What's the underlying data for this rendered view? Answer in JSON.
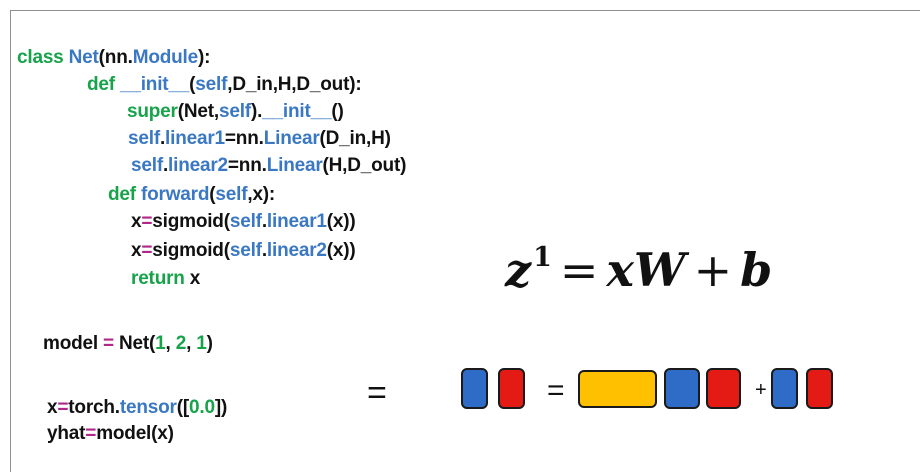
{
  "code": {
    "lines": [
      [
        {
          "t": "class ",
          "c": "keyword"
        },
        {
          "t": "Net",
          "c": "name"
        },
        {
          "t": "(nn.",
          "c": "plain"
        },
        {
          "t": "Module",
          "c": "name"
        },
        {
          "t": "):",
          "c": "plain"
        }
      ],
      [
        {
          "t": "def ",
          "c": "keyword"
        },
        {
          "t": "__init__",
          "c": "name"
        },
        {
          "t": "(",
          "c": "plain"
        },
        {
          "t": "self",
          "c": "name"
        },
        {
          "t": ",D_in,H,D_out):",
          "c": "plain"
        }
      ],
      [
        {
          "t": "super",
          "c": "keyword"
        },
        {
          "t": "(Net,",
          "c": "plain"
        },
        {
          "t": "self",
          "c": "name"
        },
        {
          "t": ").",
          "c": "plain"
        },
        {
          "t": "__init__",
          "c": "name"
        },
        {
          "t": "()",
          "c": "plain"
        }
      ],
      [
        {
          "t": "self",
          "c": "name"
        },
        {
          "t": ".",
          "c": "plain"
        },
        {
          "t": "linear1",
          "c": "name"
        },
        {
          "t": "=nn.",
          "c": "plain"
        },
        {
          "t": "Linear",
          "c": "name"
        },
        {
          "t": "(D_in,H)",
          "c": "plain"
        }
      ],
      [
        {
          "t": "self",
          "c": "name"
        },
        {
          "t": ".",
          "c": "plain"
        },
        {
          "t": "linear2",
          "c": "name"
        },
        {
          "t": "=nn.",
          "c": "plain"
        },
        {
          "t": "Linear",
          "c": "name"
        },
        {
          "t": "(H,D_out)",
          "c": "plain"
        }
      ],
      [
        {
          "t": "def ",
          "c": "keyword"
        },
        {
          "t": "forward",
          "c": "name"
        },
        {
          "t": "(",
          "c": "plain"
        },
        {
          "t": "self",
          "c": "name"
        },
        {
          "t": ",x):",
          "c": "plain"
        }
      ],
      [
        {
          "t": "x",
          "c": "plain"
        },
        {
          "t": "=",
          "c": "pink"
        },
        {
          "t": "sigmoid(",
          "c": "plain"
        },
        {
          "t": "self",
          "c": "name"
        },
        {
          "t": ".",
          "c": "plain"
        },
        {
          "t": "linear1",
          "c": "name"
        },
        {
          "t": "(x))",
          "c": "plain"
        }
      ],
      [
        {
          "t": "x",
          "c": "plain"
        },
        {
          "t": "=",
          "c": "pink"
        },
        {
          "t": "sigmoid(",
          "c": "plain"
        },
        {
          "t": "self",
          "c": "name"
        },
        {
          "t": ".",
          "c": "plain"
        },
        {
          "t": "linear2",
          "c": "name"
        },
        {
          "t": "(x))",
          "c": "plain"
        }
      ],
      [
        {
          "t": "return ",
          "c": "keyword"
        },
        {
          "t": "x",
          "c": "plain"
        }
      ],
      [
        {
          "t": "model ",
          "c": "plain"
        },
        {
          "t": "=",
          "c": "pink"
        },
        {
          "t": " Net(",
          "c": "plain"
        },
        {
          "t": "1",
          "c": "keyword"
        },
        {
          "t": ", ",
          "c": "plain"
        },
        {
          "t": "2",
          "c": "keyword"
        },
        {
          "t": ", ",
          "c": "plain"
        },
        {
          "t": "1",
          "c": "keyword"
        },
        {
          "t": ")",
          "c": "plain"
        }
      ],
      [
        {
          "t": "x",
          "c": "plain"
        },
        {
          "t": "=",
          "c": "pink"
        },
        {
          "t": "torch.",
          "c": "plain"
        },
        {
          "t": "tensor",
          "c": "name"
        },
        {
          "t": "([",
          "c": "plain"
        },
        {
          "t": "0.0",
          "c": "keyword"
        },
        {
          "t": "])",
          "c": "plain"
        }
      ],
      [
        {
          "t": "yhat",
          "c": "plain"
        },
        {
          "t": "=",
          "c": "pink"
        },
        {
          "t": "model(x)",
          "c": "plain"
        }
      ]
    ]
  },
  "equation": {
    "lhs": "z",
    "superscript": "1",
    "equals": "=",
    "term1": "xW",
    "plus": "+",
    "term2": "b"
  },
  "diagram": {
    "equals_left": "=",
    "equals_mid": "=",
    "plus": "+",
    "colors": {
      "blue": "#2f6cc8",
      "red": "#e41b14",
      "yellow": "#ffc000",
      "outline": "#1a1a1a"
    },
    "boxes": [
      "blue",
      "red",
      "yellow",
      "blue",
      "red",
      "blue",
      "red"
    ]
  }
}
